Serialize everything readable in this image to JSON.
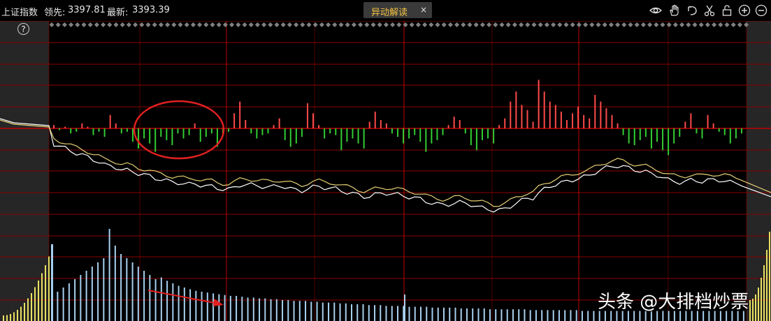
{
  "header": {
    "index_name": "上证指数",
    "lead_label": "领先:",
    "lead_value": "3397.81",
    "latest_label": "最新:",
    "latest_value": "3393.39"
  },
  "tab": {
    "label": "异动解读",
    "close": "×"
  },
  "toolbar": {
    "icons": [
      "eye-icon",
      "hand-icon",
      "back-arrow-icon",
      "scissors-icon",
      "lock-icon",
      "zoom-in-icon",
      "zoom-out-icon"
    ]
  },
  "help": {
    "label": "?"
  },
  "watermark": "头条 @大排档炒票",
  "colors": {
    "background": "#000000",
    "grid": "#8b0000",
    "grid_major": "#c00000",
    "side_panel": "#262626",
    "bar_up": "#ff4a4a",
    "bar_down": "#33cc33",
    "line": "#ffffff",
    "line2": "#ffe680",
    "volume": "#a8d0ee",
    "annotation": "#e02020",
    "diamond": "#808080"
  },
  "chart_data": {
    "type": "bar",
    "description_free": true,
    "series": [
      {
        "values": [
          0.2,
          -0.1,
          0.1,
          -0.3,
          -0.2,
          0.3,
          0.1,
          -0.4,
          -0.2,
          -0.5,
          0.8,
          0.3,
          -0.3,
          -0.2,
          -0.8,
          -1.2,
          -0.6,
          -0.9,
          -1.4,
          -0.5,
          -0.7,
          -1.0,
          -0.3,
          -0.6,
          -0.4,
          0.3,
          -0.8,
          -0.5,
          -0.3,
          -1.1,
          -0.4,
          -0.2,
          0.9,
          1.6,
          0.5,
          -0.3,
          -0.6,
          -0.4,
          -0.3,
          0.2,
          0.6,
          -0.7,
          -1.1,
          -0.9,
          -0.5,
          1.5,
          0.9,
          0.2,
          -0.6,
          -0.3,
          -0.4,
          -1.3,
          -0.8,
          -0.6,
          -0.9,
          -1.2,
          0.4,
          1.0,
          0.5,
          0.3,
          -0.3,
          -0.5,
          -0.9,
          -0.6,
          -0.4,
          -0.8,
          -1.4,
          -0.9,
          -0.7,
          -0.4,
          0.2,
          0.7,
          0.5,
          -0.3,
          -1.0,
          -1.3,
          -0.7,
          -0.6,
          -0.9,
          0.2,
          0.6,
          1.6,
          2.2,
          1.4,
          1.1,
          0.4,
          2.9,
          2.2,
          1.6,
          1.4,
          1.0,
          0.5,
          0.9,
          1.3,
          0.8,
          0.6,
          2.0,
          1.6,
          1.2,
          0.8,
          0.3,
          -0.4,
          -0.9,
          -1.0,
          -0.7,
          -0.5,
          -1.2,
          -0.8,
          -1.3,
          -1.6,
          -0.9,
          -0.5,
          0.4,
          0.9,
          -0.3,
          -0.6,
          0.8,
          0.3,
          -0.2,
          -0.4,
          -0.9,
          -0.6,
          -0.3
        ]
      }
    ],
    "volume": [
      0.3,
      0.35,
      0.4,
      0.45,
      0.5,
      0.55,
      0.6,
      0.65,
      0.7,
      0.75,
      1.1,
      0.9,
      0.8,
      0.75,
      0.7,
      0.65,
      0.6,
      0.55,
      0.5,
      0.52,
      0.48,
      0.45,
      0.42,
      0.4,
      0.38,
      0.36,
      0.35,
      0.34,
      0.33,
      0.32,
      0.31,
      0.3,
      0.3,
      0.29,
      0.28,
      0.28,
      0.27,
      0.27,
      0.26,
      0.26,
      0.25,
      0.25,
      0.24,
      0.24,
      0.24,
      0.23,
      0.23,
      0.22,
      0.22,
      0.22,
      0.21,
      0.21,
      0.2,
      0.2,
      0.2,
      0.19,
      0.19,
      0.19,
      0.18,
      0.18,
      0.18,
      0.18,
      0.17,
      0.17,
      0.17,
      0.17,
      0.16,
      0.16,
      0.16,
      0.16,
      0.16,
      0.15,
      0.15,
      0.15,
      0.15,
      0.15,
      0.14,
      0.14,
      0.14,
      0.14,
      0.14,
      0.14,
      0.14,
      0.13,
      0.13,
      0.13,
      0.13,
      0.13,
      0.13,
      0.13,
      0.13,
      0.13,
      0.12,
      0.12,
      0.12,
      0.12,
      0.12,
      0.12,
      0.12,
      0.12,
      0.12,
      0.12,
      0.12,
      0.12,
      0.12,
      0.12,
      0.12,
      0.12,
      0.12,
      0.12,
      0.12,
      0.12,
      0.12,
      0.12,
      0.12,
      0.12,
      0.12,
      0.12,
      0.12,
      0.12,
      0.12
    ]
  }
}
